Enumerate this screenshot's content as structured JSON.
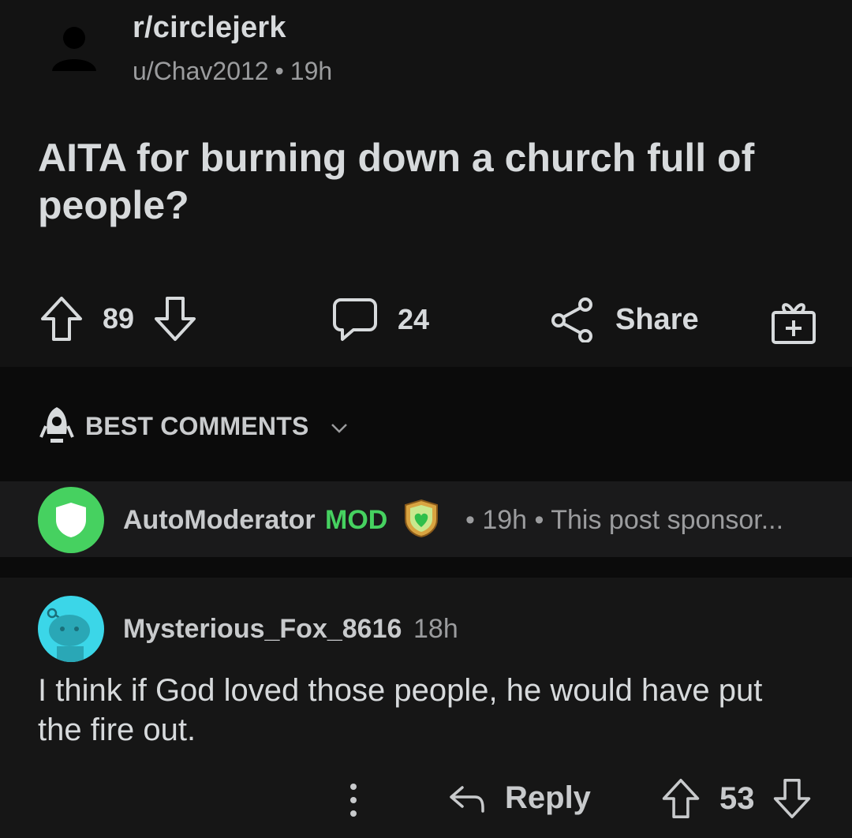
{
  "post": {
    "subreddit": "r/circlejerk",
    "author": "u/Chav2012",
    "separator": "•",
    "age": "19h",
    "title": "AITA for burning down a church full of people?",
    "upvotes": "89",
    "comments": "24",
    "share_label": "Share"
  },
  "sort": {
    "label": "BEST COMMENTS"
  },
  "comments": [
    {
      "author": "AutoModerator",
      "mod_tag": "MOD",
      "meta": "• 19h • This post sponsor...",
      "avatar_color": "#46d160"
    },
    {
      "author": "Mysterious_Fox_8616",
      "age": "18h",
      "body": "I think if God loved those people, he would have put the fire out.",
      "reply_label": "Reply",
      "score": "53",
      "avatar_color": "#3bd6e8"
    }
  ],
  "icons": [
    "user-icon",
    "upvote-icon",
    "downvote-icon",
    "comment-icon",
    "share-icon",
    "award-icon",
    "rocket-icon",
    "chevron-down-icon",
    "shield-icon",
    "mod-badge-icon",
    "snoo-avatar-icon",
    "more-icon",
    "reply-icon"
  ]
}
